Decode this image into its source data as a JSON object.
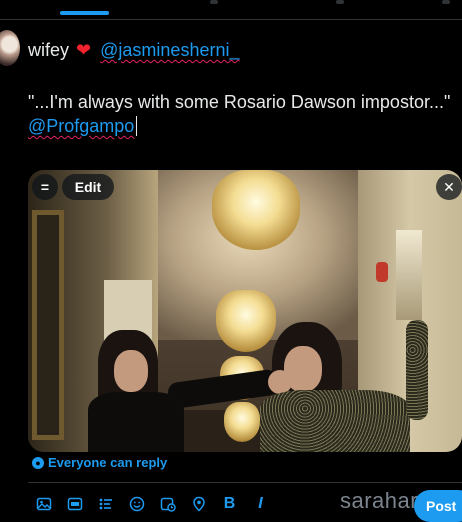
{
  "compose": {
    "name": "wifey",
    "heart": "❤",
    "mention": "@jasminesherni_",
    "quote_text": "\"...I'm always with some Rosario Dawson impostor...\"",
    "tag": "@Profgampo"
  },
  "media": {
    "edit_label": "Edit",
    "close_symbol": "✕",
    "menu_symbol": "="
  },
  "reply": {
    "label": "Everyone can reply"
  },
  "toolbar": {
    "icons": [
      "image-icon",
      "gif-icon",
      "poll-icon",
      "emoji-icon",
      "schedule-icon",
      "location-icon",
      "bold-icon",
      "italic-icon"
    ],
    "bold_label": "B",
    "italic_label": "I"
  },
  "watermark": "saraharabic",
  "post_button": "Post",
  "colors": {
    "accent": "#1d9bf0",
    "background": "#000000",
    "text": "#e7e9ea",
    "heart": "#f4212e"
  }
}
